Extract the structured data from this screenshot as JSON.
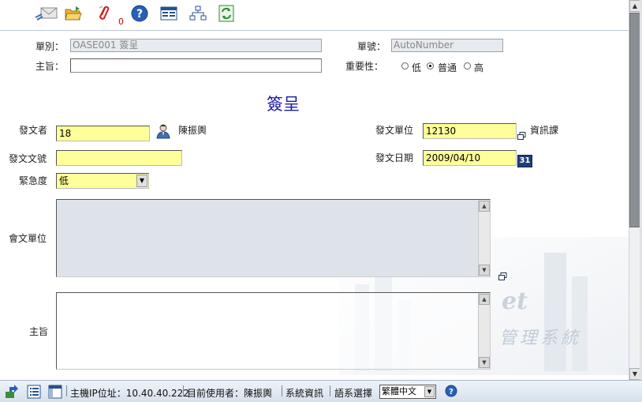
{
  "toolbar": {
    "icons": [
      "send-mail-icon",
      "open-folder-icon",
      "attachment-icon",
      "help-icon",
      "list-view-icon",
      "org-chart-icon",
      "refresh-icon"
    ],
    "attachment_count": "0"
  },
  "header": {
    "doc_type_label": "單別：",
    "doc_type_value": "OASE001 簽呈",
    "doc_no_label": "單號：",
    "doc_no_value": "AutoNumber",
    "subject_label": "主旨：",
    "subject_value": "",
    "importance_label": "重要性：",
    "importance_options": [
      "低",
      "普通",
      "高"
    ],
    "importance_selected": "普通"
  },
  "form": {
    "title": "簽呈",
    "sender_label": "發文者",
    "sender_id": "18",
    "sender_name": "陳振輿",
    "sender_unit_label": "發文單位",
    "sender_unit_value": "12130",
    "sender_unit_name": "資訊課",
    "doc_number_label": "發文文號",
    "doc_number_value": "",
    "date_label": "發文日期",
    "date_value": "2009/04/10",
    "calendar_icon_text": "31",
    "urgency_label": "緊急度",
    "urgency_value": "低",
    "cosign_label": "會文單位",
    "subject_label": "主旨"
  },
  "watermark": {
    "text_cjk": "管理系統",
    "text_latin": "et"
  },
  "statusbar": {
    "host_ip": "主機IP位址：10.40.40.222",
    "current_user": "目前使用者：陳振輿",
    "system_info": "系統資訊",
    "language_label": "語系選擇",
    "language_value": "繁體中文"
  },
  "colors": {
    "title_blue": "#1a1aa8",
    "field_yellow": "#ffff99",
    "readonly_gray": "#e7eaee"
  }
}
